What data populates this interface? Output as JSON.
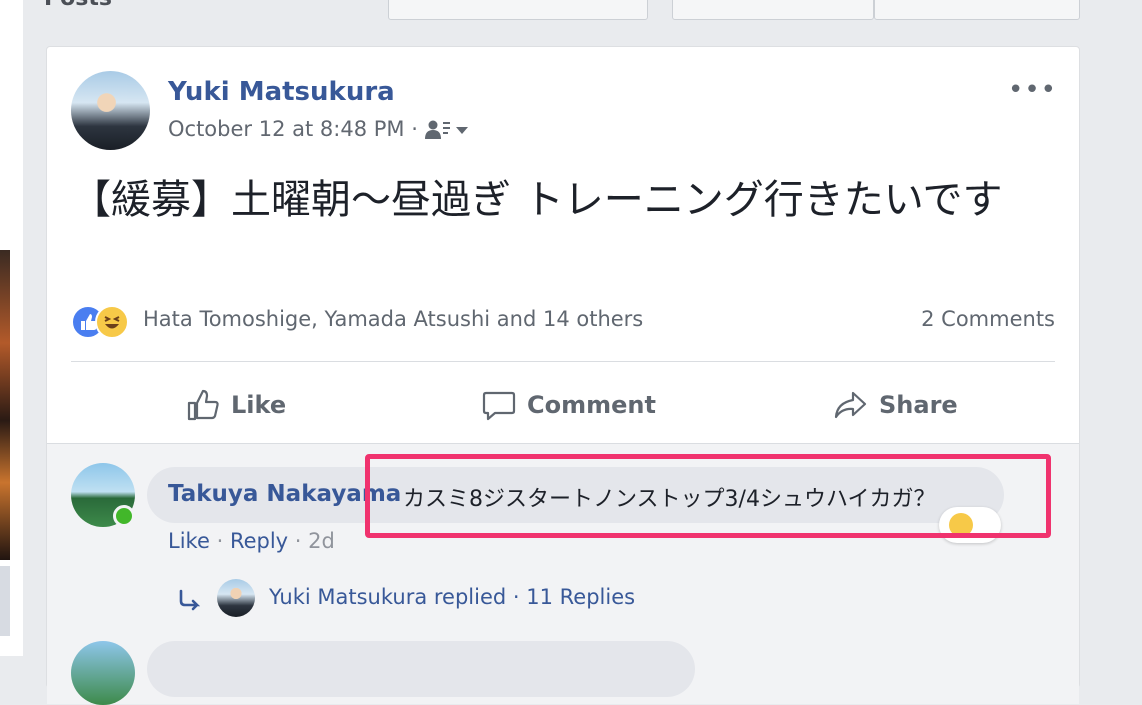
{
  "header": {
    "section_label": "Posts"
  },
  "post": {
    "author": "Yuki Matsukura",
    "timestamp": "October 12 at 8:48 PM",
    "separator": "·",
    "more_label": "•••",
    "text": "【緩募】土曜朝〜昼過ぎ トレーニング行きたいです",
    "reactions_summary": "Hata Tomoshige, Yamada Atsushi and 14 others",
    "comments_count": "2 Comments",
    "actions": {
      "like": "Like",
      "comment": "Comment",
      "share": "Share"
    }
  },
  "comment": {
    "author": "Takuya Nakayama",
    "text": "カスミ8ジスタートノンストップ3/4シュウハイカガ？",
    "like": "Like",
    "reply": "Reply",
    "time": "2d",
    "dot": "·"
  },
  "replies": {
    "summary": "Yuki Matsukura replied · 11 Replies"
  },
  "colors": {
    "link": "#385898",
    "highlight": "#f0326e",
    "like_blue": "#4a7ef0",
    "haha_yellow": "#f7c948"
  }
}
